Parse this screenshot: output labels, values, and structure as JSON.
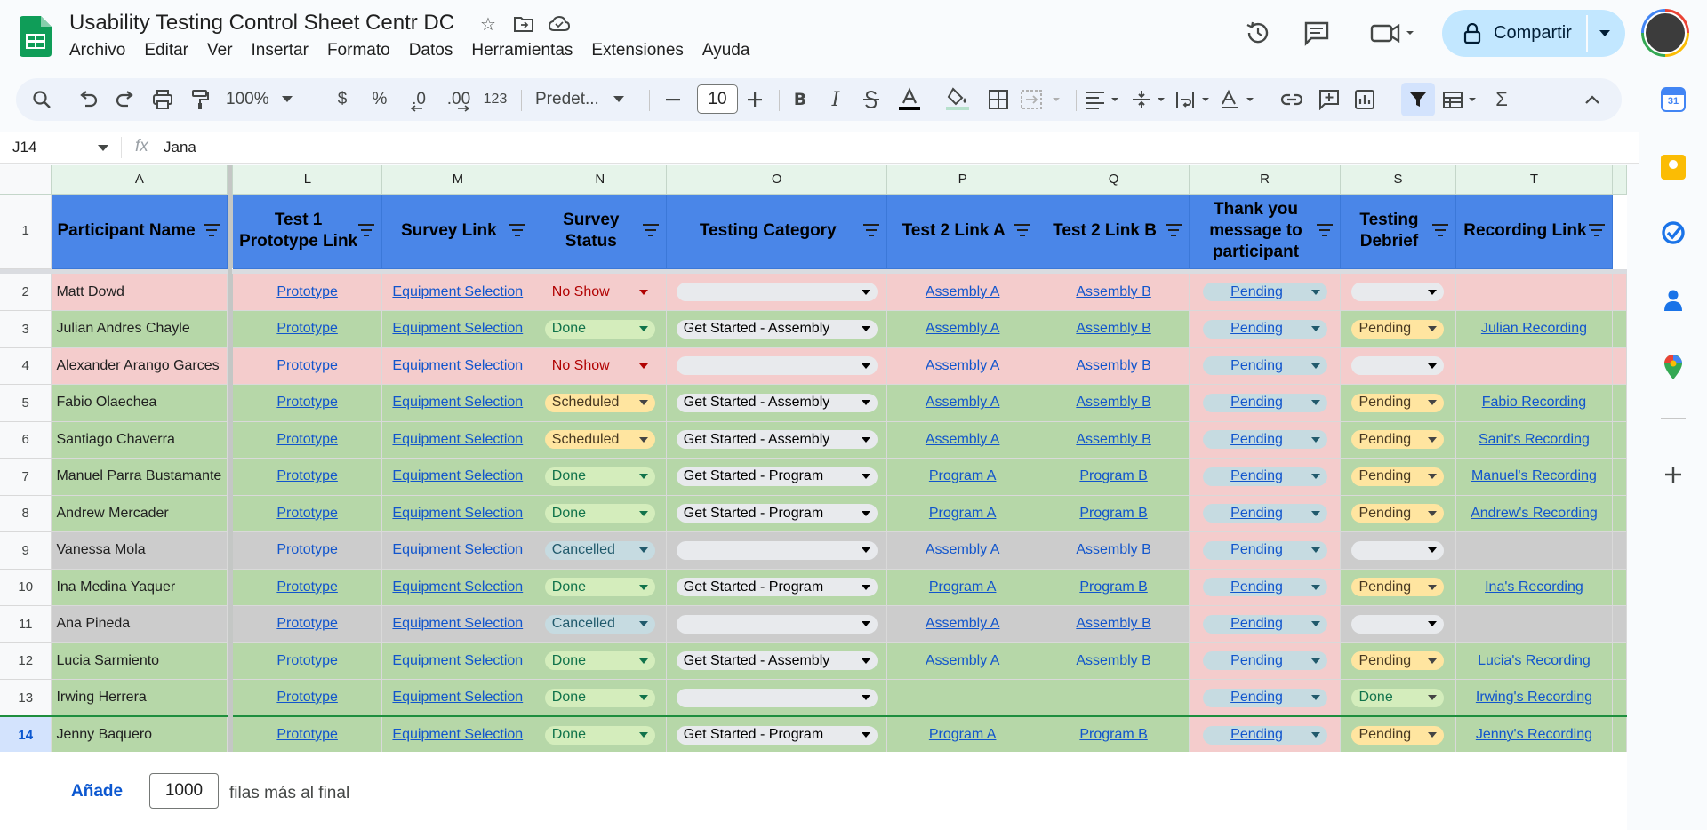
{
  "doc": {
    "title": "Usability Testing Control Sheet Centr DC"
  },
  "menu": [
    "Archivo",
    "Editar",
    "Ver",
    "Insertar",
    "Formato",
    "Datos",
    "Herramientas",
    "Extensiones",
    "Ayuda"
  ],
  "share": {
    "label": "Compartir"
  },
  "toolbar": {
    "zoom": "100%",
    "currency": "$",
    "percent": "%",
    "dec_less": ".0",
    "dec_more": ".00",
    "format_num": "123",
    "font": "Predet...",
    "font_size": "10",
    "bold": "B",
    "italic": "I",
    "sum": "Σ"
  },
  "formula_bar": {
    "cell_ref": "J14",
    "fx": "fx",
    "value": "Jana"
  },
  "columns": [
    "A",
    "L",
    "M",
    "N",
    "O",
    "P",
    "Q",
    "R",
    "S",
    "T"
  ],
  "headers": [
    "Participant Name",
    "Test 1 Prototype Link",
    "Survey Link",
    "Survey Status",
    "Testing Category",
    "Test 2 Link A",
    "Test 2 Link B",
    "Thank you message to participant",
    "Testing Debrief",
    "Recording Link"
  ],
  "rows": [
    {
      "n": "2",
      "name": "Matt Dowd",
      "proto": "Prototype",
      "survey": "Equipment Selection",
      "status": "No Show",
      "cat": "",
      "a": "Assembly A",
      "b": "Assembly B",
      "thanks": "Pending",
      "debrief": "",
      "rec": "",
      "color": "red"
    },
    {
      "n": "3",
      "name": "Julian Andres Chayle",
      "proto": "Prototype",
      "survey": "Equipment Selection",
      "status": "Done",
      "cat": "Get Started - Assembly",
      "a": "Assembly A",
      "b": "Assembly B",
      "thanks": "Pending",
      "debrief": "Pending",
      "rec": "Julian Recording",
      "color": "green"
    },
    {
      "n": "4",
      "name": "Alexander Arango Garces",
      "proto": "Prototype",
      "survey": "Equipment Selection",
      "status": "No Show",
      "cat": "",
      "a": "Assembly A",
      "b": "Assembly B",
      "thanks": "Pending",
      "debrief": "",
      "rec": "",
      "color": "red"
    },
    {
      "n": "5",
      "name": "Fabio Olaechea",
      "proto": "Prototype",
      "survey": "Equipment Selection",
      "status": "Scheduled",
      "cat": "Get Started - Assembly",
      "a": "Assembly A",
      "b": "Assembly B",
      "thanks": "Pending",
      "debrief": "Pending",
      "rec": "Fabio Recording",
      "color": "green"
    },
    {
      "n": "6",
      "name": "Santiago Chaverra",
      "proto": "Prototype",
      "survey": "Equipment Selection",
      "status": "Scheduled",
      "cat": "Get Started - Assembly",
      "a": "Assembly A",
      "b": "Assembly B",
      "thanks": "Pending",
      "debrief": "Pending",
      "rec": "Sanit's Recording",
      "color": "green"
    },
    {
      "n": "7",
      "name": "Manuel Parra Bustamante",
      "proto": "Prototype",
      "survey": "Equipment Selection",
      "status": "Done",
      "cat": "Get Started - Program",
      "a": "Program A",
      "b": "Program B",
      "thanks": "Pending",
      "debrief": "Pending",
      "rec": "Manuel's Recording",
      "color": "green"
    },
    {
      "n": "8",
      "name": "Andrew Mercader",
      "proto": "Prototype",
      "survey": "Equipment Selection",
      "status": "Done",
      "cat": "Get Started - Program",
      "a": "Program A",
      "b": "Program B",
      "thanks": "Pending",
      "debrief": "Pending",
      "rec": "Andrew's Recording",
      "color": "green"
    },
    {
      "n": "9",
      "name": "Vanessa Mola",
      "proto": "Prototype",
      "survey": "Equipment Selection",
      "status": "Cancelled",
      "cat": "",
      "a": "Assembly A",
      "b": "Assembly B",
      "thanks": "Pending",
      "debrief": "",
      "rec": "",
      "color": "gray"
    },
    {
      "n": "10",
      "name": "Ina Medina Yaquer",
      "proto": "Prototype",
      "survey": "Equipment Selection",
      "status": "Done",
      "cat": "Get Started - Program",
      "a": "Program A",
      "b": "Program B",
      "thanks": "Pending",
      "debrief": "Pending",
      "rec": "Ina's Recording",
      "color": "green"
    },
    {
      "n": "11",
      "name": "Ana Pineda",
      "proto": "Prototype",
      "survey": "Equipment Selection",
      "status": "Cancelled",
      "cat": "",
      "a": "Assembly A",
      "b": "Assembly B",
      "thanks": "Pending",
      "debrief": "",
      "rec": "",
      "color": "gray"
    },
    {
      "n": "12",
      "name": "Lucia Sarmiento",
      "proto": "Prototype",
      "survey": "Equipment Selection",
      "status": "Done",
      "cat": "Get Started - Assembly",
      "a": "Assembly A",
      "b": "Assembly B",
      "thanks": "Pending",
      "debrief": "Pending",
      "rec": "Lucia's Recording",
      "color": "green"
    },
    {
      "n": "13",
      "name": "Irwing Herrera",
      "proto": "Prototype",
      "survey": "Equipment Selection",
      "status": "Done",
      "cat": "",
      "a": "",
      "b": "",
      "thanks": "Pending",
      "debrief": "Done",
      "rec": "Irwing's Recording",
      "color": "green"
    },
    {
      "n": "14",
      "name": "Jenny Baquero",
      "proto": "Prototype",
      "survey": "Equipment Selection",
      "status": "Done",
      "cat": "Get Started - Program",
      "a": "Program A",
      "b": "Program B",
      "thanks": "Pending",
      "debrief": "Pending",
      "rec": "Jenny's Recording",
      "color": "green"
    }
  ],
  "row_header_number": "1",
  "footer": {
    "add_label": "Añade",
    "rows_value": "1000",
    "suffix": "filas más al final"
  },
  "colors": {
    "header_blue": "#4a86e8",
    "row_red": "#f4cccc",
    "row_green": "#b6d7a8",
    "row_gray": "#cccccc",
    "share_bg": "#c2e7ff"
  }
}
